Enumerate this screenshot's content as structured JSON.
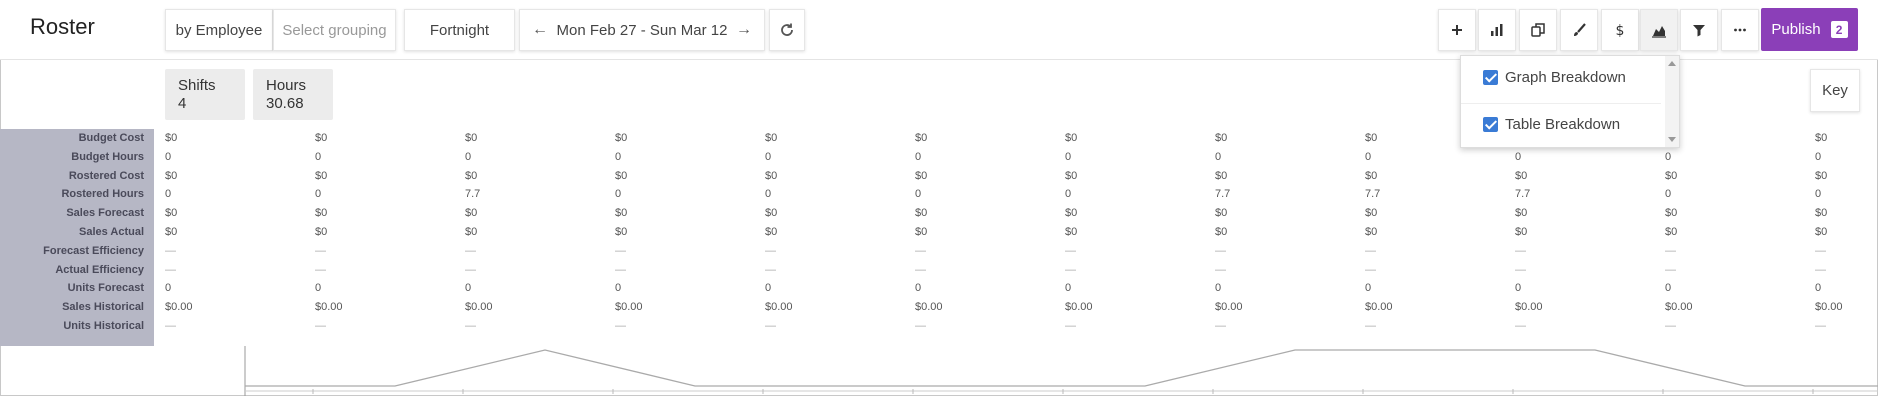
{
  "header": {
    "title": "Roster",
    "group_by": "by Employee",
    "grouping_placeholder": "Select grouping",
    "period": "Fortnight",
    "date_range": "Mon Feb 27 - Sun Mar 12",
    "prev_icon": "arrow-left-icon",
    "next_icon": "arrow-right-icon",
    "refresh_icon": "refresh-icon",
    "tools": [
      {
        "name": "add-icon",
        "glyph": "+"
      },
      {
        "name": "bar-chart-icon",
        "glyph": "bars"
      },
      {
        "name": "copy-icon",
        "glyph": "copy"
      },
      {
        "name": "brush-icon",
        "glyph": "brush"
      },
      {
        "name": "dollar-icon",
        "glyph": "$"
      },
      {
        "name": "area-chart-icon",
        "glyph": "area"
      },
      {
        "name": "filter-icon",
        "glyph": "filter"
      },
      {
        "name": "more-icon",
        "glyph": "···"
      }
    ],
    "publish_label": "Publish",
    "publish_count": "2",
    "accent_color": "#8b3fb8"
  },
  "stats": {
    "shifts_label": "Shifts",
    "shifts_value": "4",
    "hours_label": "Hours",
    "hours_value": "30.68"
  },
  "key_label": "Key",
  "dropdown": {
    "items": [
      {
        "label": "Graph Breakdown",
        "checked": true
      },
      {
        "label": "Table Breakdown",
        "checked": true
      }
    ]
  },
  "table": {
    "row_labels": [
      "Budget Cost",
      "Budget Hours",
      "Rostered Cost",
      "Rostered Hours",
      "Sales Forecast",
      "Sales Actual",
      "Forecast Efficiency",
      "Actual Efficiency",
      "Units Forecast",
      "Sales Historical",
      "Units Historical"
    ],
    "columns": [
      [
        "$0",
        "0",
        "$0",
        "0",
        "$0",
        "$0",
        "—",
        "—",
        "0",
        "$0.00",
        "—"
      ],
      [
        "$0",
        "0",
        "$0",
        "0",
        "$0",
        "$0",
        "—",
        "—",
        "0",
        "$0.00",
        "—"
      ],
      [
        "$0",
        "0",
        "$0",
        "7.7",
        "$0",
        "$0",
        "—",
        "—",
        "0",
        "$0.00",
        "—"
      ],
      [
        "$0",
        "0",
        "$0",
        "0",
        "$0",
        "$0",
        "—",
        "—",
        "0",
        "$0.00",
        "—"
      ],
      [
        "$0",
        "0",
        "$0",
        "0",
        "$0",
        "$0",
        "—",
        "—",
        "0",
        "$0.00",
        "—"
      ],
      [
        "$0",
        "0",
        "$0",
        "0",
        "$0",
        "$0",
        "—",
        "—",
        "0",
        "$0.00",
        "—"
      ],
      [
        "$0",
        "0",
        "$0",
        "0",
        "$0",
        "$0",
        "—",
        "—",
        "0",
        "$0.00",
        "—"
      ],
      [
        "$0",
        "0",
        "$0",
        "7.7",
        "$0",
        "$0",
        "—",
        "—",
        "0",
        "$0.00",
        "—"
      ],
      [
        "$0",
        "0",
        "$0",
        "7.7",
        "$0",
        "$0",
        "—",
        "—",
        "0",
        "$0.00",
        "—"
      ],
      [
        "$0",
        "0",
        "$0",
        "7.7",
        "$0",
        "$0",
        "—",
        "—",
        "0",
        "$0.00",
        "—"
      ],
      [
        "$0",
        "0",
        "$0",
        "0",
        "$0",
        "$0",
        "—",
        "—",
        "0",
        "$0.00",
        "—"
      ],
      [
        "$0",
        "0",
        "$0",
        "0",
        "$0",
        "$0",
        "—",
        "—",
        "0",
        "$0.00",
        "—"
      ]
    ]
  },
  "graph": {
    "series": [
      0,
      0,
      7.7,
      0,
      0,
      0,
      0,
      7.7,
      7.7,
      7.7,
      0,
      0
    ]
  }
}
